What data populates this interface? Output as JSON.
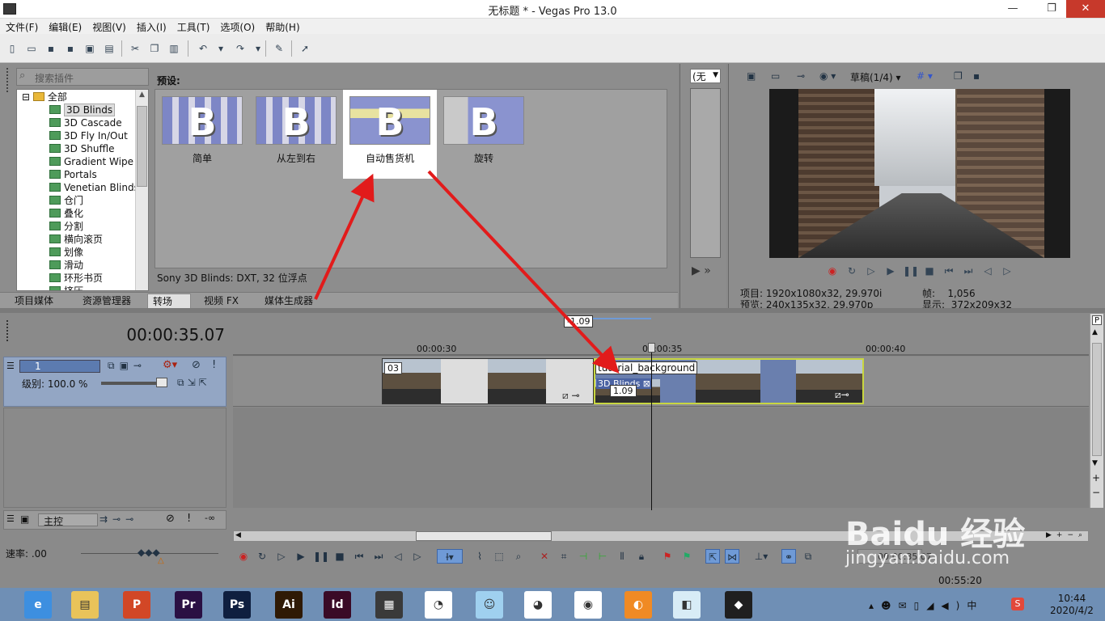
{
  "window": {
    "title": "无标题 * - Vegas Pro 13.0",
    "minimize": "—",
    "maximize": "❐",
    "close": "✕"
  },
  "menu": [
    "文件(F)",
    "编辑(E)",
    "视图(V)",
    "插入(I)",
    "工具(T)",
    "选项(O)",
    "帮助(H)"
  ],
  "plugin_chooser": {
    "search_placeholder": "搜索插件",
    "tree": {
      "root": "全部",
      "items": [
        "3D Blinds",
        "3D Cascade",
        "3D Fly In/Out",
        "3D Shuffle",
        "Gradient Wipe",
        "Portals",
        "Venetian Blinds",
        "仓门",
        "叠化",
        "分割",
        "横向滚页",
        "划像",
        "滑动",
        "环形书页",
        "挤压"
      ],
      "selected": "3D Blinds"
    },
    "presets_label": "预设:",
    "presets": [
      {
        "label": "简单",
        "glyph": "B"
      },
      {
        "label": "从左到右",
        "glyph": "B"
      },
      {
        "label": "自动售货机",
        "glyph": "B"
      },
      {
        "label": "旋转",
        "glyph": "B"
      }
    ],
    "selected_preset": "自动售货机",
    "status": "Sony 3D Blinds: DXT, 32 位浮点",
    "tabs": [
      "项目媒体",
      "资源管理器",
      "转场",
      "视频 FX",
      "媒体生成器"
    ],
    "active_tab": "转场"
  },
  "middle_panel": {
    "dropdown": "(无"
  },
  "preview": {
    "quality": "草稿(1/4)",
    "project_label": "项目:",
    "project_value": "1920x1080x32, 29.970i",
    "preview_label": "预览:",
    "preview_value": "240x135x32, 29.970p",
    "frame_label": "帧:",
    "frame_value": "1,056",
    "display_label": "显示:",
    "display_value": "372x209x32"
  },
  "timeline": {
    "timecode": "00:00:35.07",
    "ruler_ticks": [
      "00:00:30",
      "00:00:35",
      "00:00:40"
    ],
    "marker_top": "-1.09",
    "track1": {
      "number": "1",
      "level": "级别: 100.0 %"
    },
    "clip1": {
      "name": "03"
    },
    "clip2": {
      "name": "tutorial_background",
      "fx": "3D Blinds",
      "overlap": "1.09"
    },
    "master": {
      "name": "主控"
    },
    "rate": "速率: .00",
    "end_time": "00:00:35.07",
    "status_end": "00:55:20"
  },
  "taskbar": {
    "apps": [
      {
        "name": "browser",
        "glyph": "e",
        "color": "#3d8fe0"
      },
      {
        "name": "explorer",
        "glyph": "▤",
        "color": "#e9c35a"
      },
      {
        "name": "powerpoint",
        "glyph": "P",
        "color": "#d24726"
      },
      {
        "name": "premiere",
        "glyph": "Pr",
        "color": "#2a1043"
      },
      {
        "name": "photoshop",
        "glyph": "Ps",
        "color": "#0f1f3f"
      },
      {
        "name": "illustrator",
        "glyph": "Ai",
        "color": "#2f1a05"
      },
      {
        "name": "indesign",
        "glyph": "Id",
        "color": "#3a0a26"
      },
      {
        "name": "vegas",
        "glyph": "▦",
        "color": "#3a3a3a"
      },
      {
        "name": "umbrella-app",
        "glyph": "◔",
        "color": "#ffffff"
      },
      {
        "name": "chat-app",
        "glyph": "☺",
        "color": "#9fd0ef"
      },
      {
        "name": "qq",
        "glyph": "◕",
        "color": "#ffffff"
      },
      {
        "name": "chrome",
        "glyph": "◉",
        "color": "#ffffff"
      },
      {
        "name": "fox-app",
        "glyph": "◐",
        "color": "#f08a24"
      },
      {
        "name": "note-app",
        "glyph": "◧",
        "color": "#d8ecf6"
      },
      {
        "name": "green-app",
        "glyph": "◆",
        "color": "#1f1f1f"
      }
    ],
    "time": "10:44",
    "date": "2020/4/2"
  },
  "watermark": {
    "text": "Baidu 经验",
    "url": "jingyan.baidu.com"
  },
  "colors": {
    "accent": "#6f9ad6",
    "arrow": "#e21b1b",
    "clip_border": "#c8d640"
  }
}
